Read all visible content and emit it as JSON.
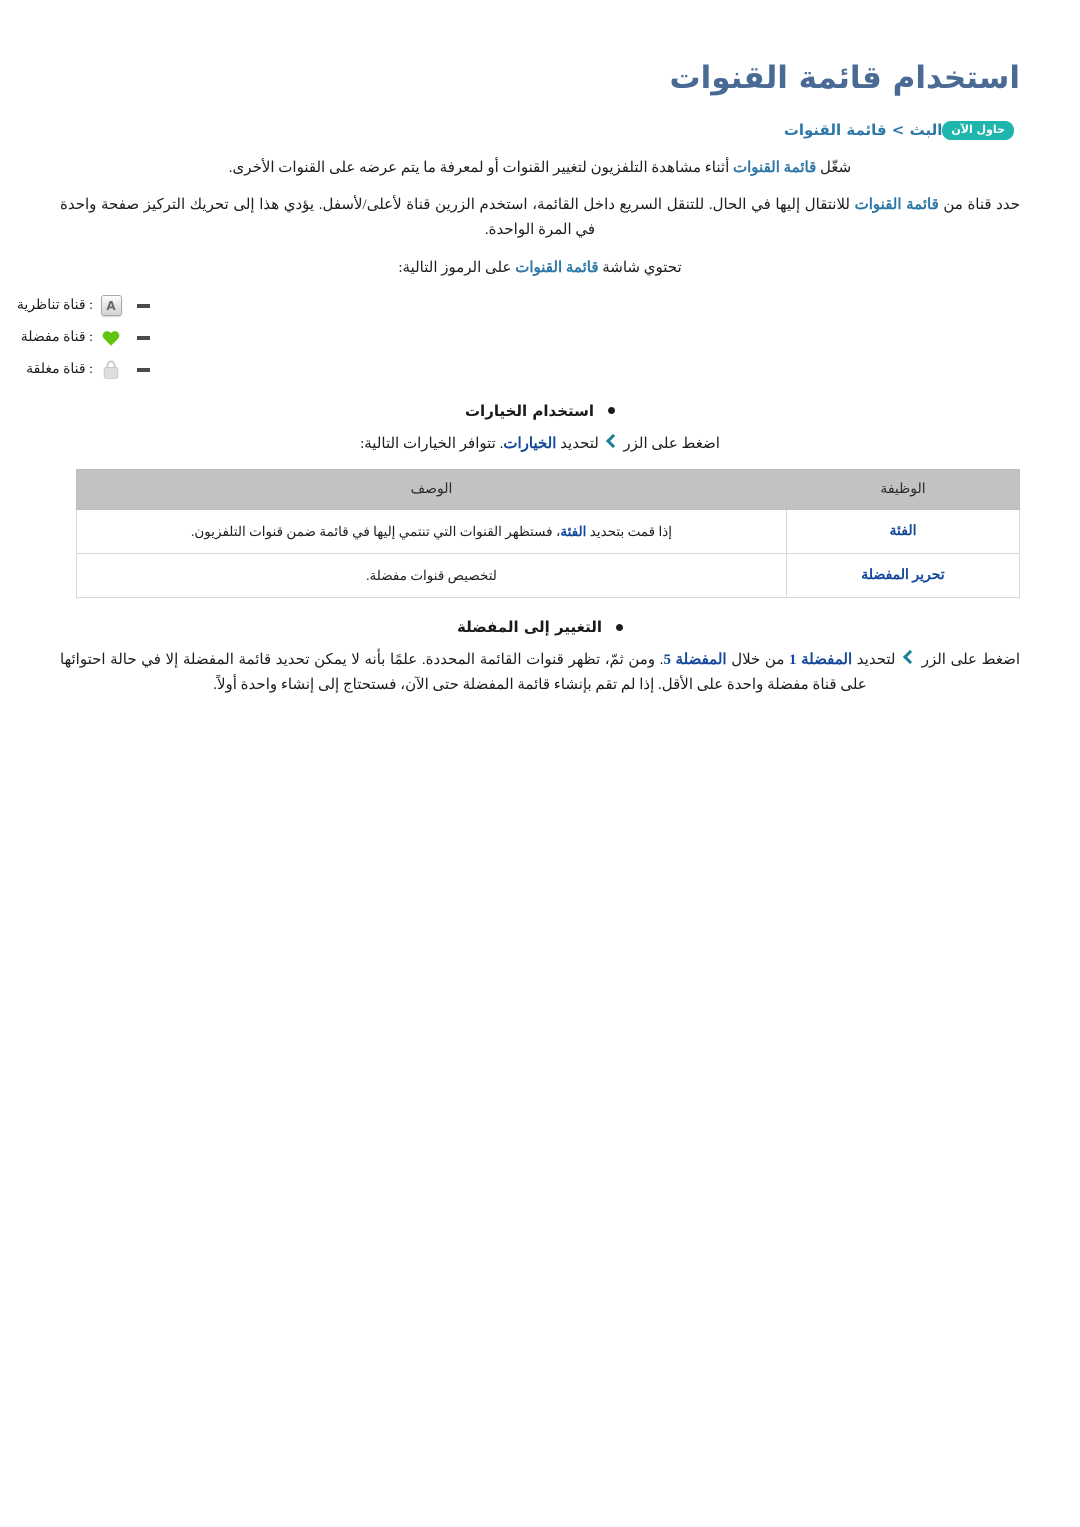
{
  "page": {
    "title": "استخدام قائمة القنوات",
    "language": "ar",
    "direction": "rtl"
  },
  "breadcrumb": {
    "path": "البث > قائمة القنوات",
    "badge_label": "حاول الآن",
    "badge_color": "#1eb5ad",
    "text_color": "#2e78a8"
  },
  "intro": {
    "p1_before": "شغّل ",
    "p1_link": "قائمة القنوات",
    "p1_after": " أثناء مشاهدة التلفزيون لتغيير القنوات أو لمعرفة ما يتم عرضه على القنوات الأخرى.",
    "p2_before": "حدد قناة من ",
    "p2_link": "قائمة القنوات",
    "p2_after": " للانتقال إليها في الحال. للتنقل السريع داخل القائمة، استخدم الزرين قناة لأعلى/لأسفل. يؤدي هذا إلى تحريك التركيز صفحة واحدة في المرة الواحدة.",
    "p3_before": "تحتوي شاشة ",
    "p3_link": "قائمة القنوات",
    "p3_after": " على الرموز التالية:"
  },
  "icon_legend": [
    {
      "icon": "analog-a-box-icon",
      "label": ": قناة تناظرية",
      "glyph": "A"
    },
    {
      "icon": "green-heart-icon",
      "label": ": قناة مفضلة",
      "color": "#62c40f"
    },
    {
      "icon": "gray-padlock-icon",
      "label": ": قناة مغلقة",
      "color": "#d5d5d5"
    }
  ],
  "options_section": {
    "heading": "استخدام الخيارات",
    "instruction_before": "اضغط على الزر ",
    "instruction_chevron": "chevron-left-icon",
    "instruction_mid": " لتحديد ",
    "instruction_link": "الخيارات",
    "instruction_after": ". تتوافر الخيارات التالية:",
    "table": {
      "headers": [
        "الوظيفة",
        "الوصف"
      ],
      "rows": [
        {
          "function": "الفئة",
          "description_before": "إذا قمت بتحديد ",
          "description_link": "الفئة",
          "description_after": "، فستظهر القنوات التي تنتمي إليها في قائمة ضمن قنوات التلفزيون."
        },
        {
          "function": "تحرير المفضلة",
          "description_before": "",
          "description_link": "",
          "description_after": "لتخصيص قنوات مفضلة."
        }
      ]
    }
  },
  "favorites_section": {
    "heading": "التغيير إلى المفضلة",
    "line_a_1": "اضغط على الزر ",
    "line_a_chevron": "chevron-left-icon",
    "line_a_2": " لتحديد ",
    "line_a_link1": "المفضلة 1",
    "line_a_3": " من خلال ",
    "line_a_link2": "المفضلة 5",
    "line_a_4": ". ومن ثمّ، تظهر قنوات القائمة المحددة. علمًا بأنه لا يمكن تحديد قائمة المفضلة إلا في حالة احتوائها على قناة مفضلة واحدة على الأقل. إذا لم تقم بإنشاء قائمة المفضلة حتى الآن، فستحتاج إلى إنشاء واحدة أولاً."
  }
}
